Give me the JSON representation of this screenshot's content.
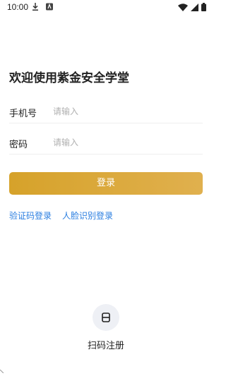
{
  "status_bar": {
    "time": "10:00",
    "icons": [
      "download-icon",
      "app-notification-icon",
      "wifi-icon",
      "signal-icon",
      "battery-icon"
    ]
  },
  "title": "欢迎使用紫金安全学堂",
  "form": {
    "phone": {
      "label": "手机号",
      "placeholder": "请输入",
      "value": ""
    },
    "password": {
      "label": "密码",
      "placeholder": "请输入",
      "value": ""
    }
  },
  "login_button_label": "登录",
  "links": {
    "sms_login": "验证码登录",
    "face_login": "人脸识别登录"
  },
  "scan_register_label": "扫码注册",
  "colors": {
    "accent_start": "#d6a22a",
    "accent_end": "#e0b04e",
    "link": "#2a7ee0",
    "placeholder": "#b0b0b0"
  }
}
